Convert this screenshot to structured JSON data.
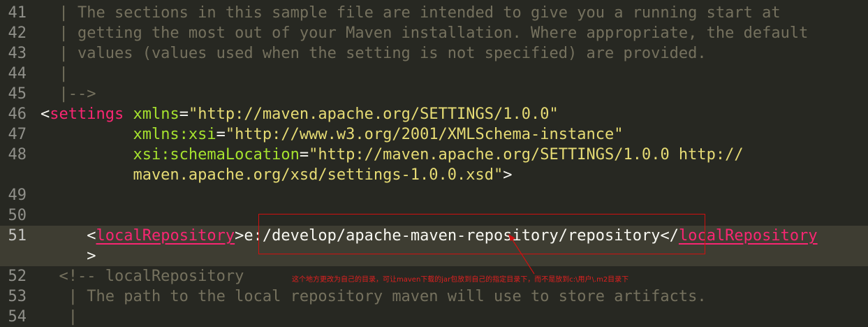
{
  "editor": {
    "lines": [
      {
        "num": "41",
        "parts": [
          {
            "cls": "c-comment",
            "text": "  | The sections in this sample file are intended to give you a running start at"
          }
        ]
      },
      {
        "num": "42",
        "parts": [
          {
            "cls": "c-comment",
            "text": "  | getting the most out of your Maven installation. Where appropriate, the default"
          }
        ]
      },
      {
        "num": "43",
        "parts": [
          {
            "cls": "c-comment",
            "text": "  | values (values used when the setting is not specified) are provided."
          }
        ]
      },
      {
        "num": "44",
        "parts": [
          {
            "cls": "c-comment",
            "text": "  |"
          }
        ]
      },
      {
        "num": "45",
        "parts": [
          {
            "cls": "c-comment",
            "text": "  |-->"
          }
        ]
      },
      {
        "num": "46",
        "parts": [
          {
            "cls": "c-punct",
            "text": "<"
          },
          {
            "cls": "c-tag",
            "text": "settings"
          },
          {
            "cls": "c-text",
            "text": " "
          },
          {
            "cls": "c-attr",
            "text": "xmlns"
          },
          {
            "cls": "c-punct",
            "text": "="
          },
          {
            "cls": "c-str",
            "text": "\"http://maven.apache.org/SETTINGS/1.0.0\""
          }
        ]
      },
      {
        "num": "47",
        "parts": [
          {
            "cls": "c-text",
            "text": "          "
          },
          {
            "cls": "c-attr",
            "text": "xmlns:xsi"
          },
          {
            "cls": "c-punct",
            "text": "="
          },
          {
            "cls": "c-str",
            "text": "\"http://www.w3.org/2001/XMLSchema-instance\""
          }
        ]
      },
      {
        "num": "48",
        "parts": [
          {
            "cls": "c-text",
            "text": "          "
          },
          {
            "cls": "c-attr",
            "text": "xsi:schemaLocation"
          },
          {
            "cls": "c-punct",
            "text": "="
          },
          {
            "cls": "c-str",
            "text": "\"http://maven.apache.org/SETTINGS/1.0.0 http://"
          }
        ]
      },
      {
        "num": "",
        "parts": [
          {
            "cls": "c-str",
            "text": "          maven.apache.org/xsd/settings-1.0.0.xsd\""
          },
          {
            "cls": "c-punct",
            "text": ">"
          }
        ]
      },
      {
        "num": "49",
        "parts": []
      },
      {
        "num": "50",
        "parts": []
      },
      {
        "num": "51",
        "active": true,
        "parts": [
          {
            "cls": "c-text",
            "text": "     "
          },
          {
            "cls": "c-punct",
            "text": "<"
          },
          {
            "cls": "c-tag underline",
            "text": "localRepository"
          },
          {
            "cls": "c-punct",
            "text": ">"
          },
          {
            "cls": "c-text",
            "text": "e:/develop/apache-maven-repository/repository"
          },
          {
            "cls": "c-punct",
            "text": "</"
          },
          {
            "cls": "c-tag underline",
            "text": "localRepository"
          }
        ]
      },
      {
        "num": "",
        "active": true,
        "parts": [
          {
            "cls": "c-punct",
            "text": "     >"
          }
        ]
      },
      {
        "num": "52",
        "parts": [
          {
            "cls": "c-comment",
            "text": "  <!-- localRepository"
          }
        ]
      },
      {
        "num": "53",
        "parts": [
          {
            "cls": "c-comment",
            "text": "   | The path to the local repository maven will use to store artifacts."
          }
        ]
      },
      {
        "num": "54",
        "parts": [
          {
            "cls": "c-comment",
            "text": "   |"
          }
        ]
      }
    ]
  },
  "annotation": {
    "text": "这个地方更改为自己的目录，可让maven下载的jar包放到自己的指定目录下，而不是放到c:\\用户\\.m2目录下",
    "color": "#d01010"
  }
}
